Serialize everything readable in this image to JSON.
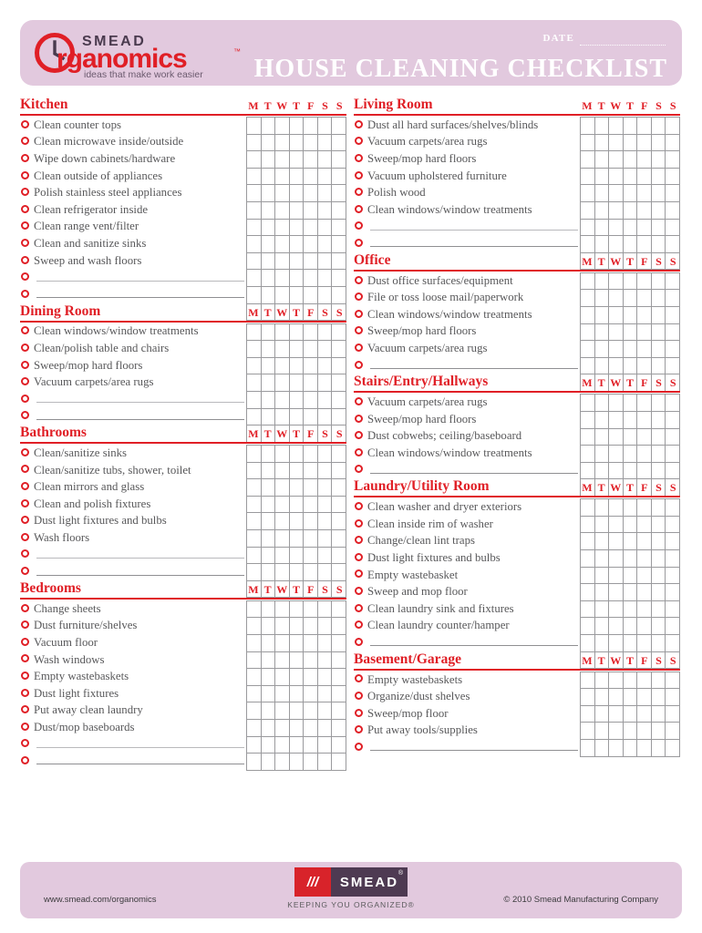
{
  "header": {
    "logo": {
      "smead_word": "SMEAD",
      "organomics_word": "rganomics",
      "tm": "™",
      "tagline": "ideas that make work easier",
      "circle_icon": "clock-circle-icon"
    },
    "date_label": "DATE",
    "date_value": "",
    "title": "HOUSE CLEANING CHECKLIST",
    "band_color": "#e2c9de",
    "accent_color": "#e01f26"
  },
  "days": [
    "M",
    "T",
    "W",
    "T",
    "F",
    "S",
    "S"
  ],
  "blank_item_label": "",
  "left_sections": [
    {
      "title": "Kitchen",
      "items": [
        "Clean counter tops",
        "Clean microwave inside/outside",
        "Wipe down cabinets/hardware",
        "Clean outside of appliances",
        "Polish stainless steel appliances",
        "Clean refrigerator inside",
        "Clean range vent/filter",
        "Clean and sanitize sinks",
        "Sweep and wash floors"
      ],
      "blank_rows": 2,
      "grid_rows": 12
    },
    {
      "title": "Dining Room",
      "items": [
        "Clean windows/window treatments",
        "Clean/polish table and chairs",
        "Sweep/mop hard floors",
        "Vacuum carpets/area rugs"
      ],
      "blank_rows": 2,
      "grid_rows": 7
    },
    {
      "title": "Bathrooms",
      "items": [
        "Clean/sanitize sinks",
        "Clean/sanitize tubs, shower, toilet",
        "Clean mirrors and glass",
        "Clean and polish fixtures",
        "Dust light fixtures and bulbs",
        "Wash floors"
      ],
      "blank_rows": 2,
      "grid_rows": 9
    },
    {
      "title": "Bedrooms",
      "items": [
        "Change sheets",
        "Dust furniture/shelves",
        "Vacuum floor",
        "Wash windows",
        "Empty wastebaskets",
        "Dust light fixtures",
        "Put away clean laundry",
        "Dust/mop baseboards"
      ],
      "blank_rows": 2,
      "grid_rows": 10
    }
  ],
  "right_sections": [
    {
      "title": "Living Room",
      "items": [
        "Dust all hard surfaces/shelves/blinds",
        "Vacuum carpets/area rugs",
        "Sweep/mop hard floors",
        "Vacuum upholstered furniture",
        "Polish wood",
        "Clean windows/window treatments"
      ],
      "blank_rows": 2,
      "grid_rows": 9
    },
    {
      "title": "Office",
      "items": [
        "Dust office surfaces/equipment",
        "File or toss loose mail/paperwork",
        "Clean windows/window treatments",
        "Sweep/mop hard floors",
        "Vacuum carpets/area rugs"
      ],
      "blank_rows": 1,
      "grid_rows": 7
    },
    {
      "title": "Stairs/Entry/Hallways",
      "items": [
        "Vacuum carpets/area rugs",
        "Sweep/mop hard floors",
        "Dust cobwebs; ceiling/baseboard",
        "Clean windows/window treatments"
      ],
      "blank_rows": 1,
      "grid_rows": 6
    },
    {
      "title": "Laundry/Utility Room",
      "items": [
        "Clean washer and dryer exteriors",
        "Clean inside rim of washer",
        "Change/clean lint traps",
        "Dust light fixtures and bulbs",
        "Empty wastebasket",
        "Sweep and mop floor",
        "Clean laundry sink and fixtures",
        "Clean laundry counter/hamper"
      ],
      "blank_rows": 1,
      "grid_rows": 10
    },
    {
      "title": "Basement/Garage",
      "items": [
        "Empty wastebaskets",
        "Organize/dust shelves",
        "Sweep/mop floor",
        "Put away tools/supplies"
      ],
      "blank_rows": 1,
      "grid_rows": 5
    }
  ],
  "footer": {
    "url": "www.smead.com/organomics",
    "copyright": "© 2010 Smead Manufacturing Company",
    "logo_mark": "///",
    "logo_word": "SMEAD",
    "logo_reg": "®",
    "tagline": "KEEPING YOU ORGANIZED®"
  }
}
